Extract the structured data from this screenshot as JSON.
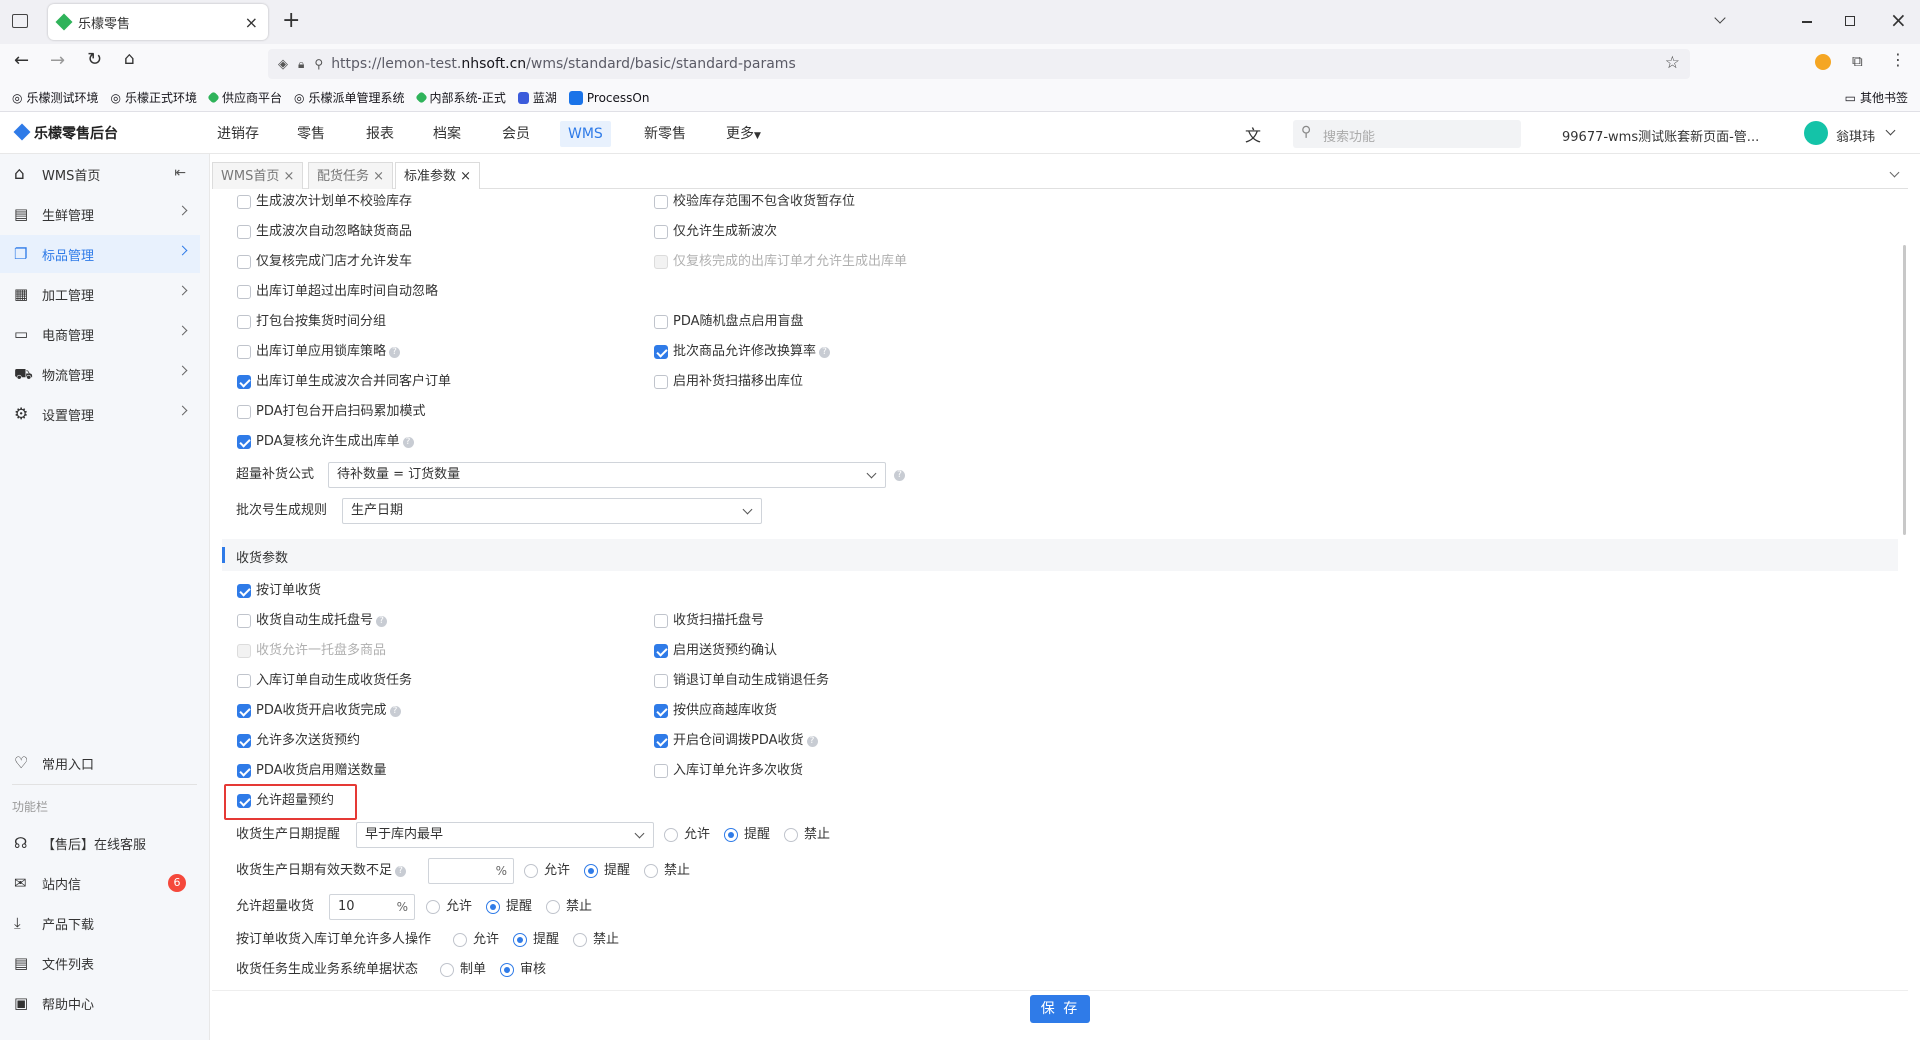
{
  "browser": {
    "tab_title": "乐檬零售",
    "url_prefix": "https://lemon-test.",
    "url_domain": "nhsoft.cn",
    "url_path": "/wms/standard/basic/standard-params",
    "bookmarks": [
      "乐檬测试环境",
      "乐檬正式环境",
      "供应商平台",
      "乐檬派单管理系统",
      "内部系统-正式",
      "蓝湖",
      "ProcessOn"
    ],
    "other_bookmarks": "其他书签"
  },
  "header": {
    "logo": "乐檬零售后台",
    "nav": [
      "进销存",
      "零售",
      "报表",
      "档案",
      "会员",
      "WMS",
      "新零售",
      "更多"
    ],
    "active_nav": "WMS",
    "search_placeholder": "搜索功能",
    "account": "99677-wms测试账套新页面-管...",
    "user": "翁琪玮"
  },
  "sidebar": {
    "items": [
      "WMS首页",
      "生鲜管理",
      "标品管理",
      "加工管理",
      "电商管理",
      "物流管理",
      "设置管理"
    ],
    "active": "标品管理",
    "common_entry": "常用入口",
    "func_bar": "功能栏",
    "func_items": [
      "【售后】在线客服",
      "站内信",
      "产品下载",
      "文件列表",
      "帮助中心"
    ],
    "message_badge": "6"
  },
  "page_tabs": [
    "WMS首页",
    "配货任务",
    "标准参数"
  ],
  "active_tab": "标准参数",
  "shipping_options": {
    "left": [
      {
        "label": "生成波次计划单不校验库存",
        "checked": false
      },
      {
        "label": "生成波次自动忽略缺货商品",
        "checked": false
      },
      {
        "label": "仅复核完成门店才允许发车",
        "checked": false
      },
      {
        "label": "出库订单超过出库时间自动忽略",
        "checked": false
      },
      {
        "label": "打包台按集货时间分组",
        "checked": false
      },
      {
        "label": "出库订单应用锁库策略",
        "checked": false,
        "help": true
      },
      {
        "label": "出库订单生成波次合并同客户订单",
        "checked": true
      },
      {
        "label": "PDA打包台开启扫码累加模式",
        "checked": false
      },
      {
        "label": "PDA复核允许生成出库单",
        "checked": true,
        "help": true
      }
    ],
    "right": [
      {
        "label": "校验库存范围不包含收货暂存位",
        "checked": false
      },
      {
        "label": "仅允许生成新波次",
        "checked": false
      },
      {
        "label": "仅复核完成的出库订单才允许生成出库单",
        "checked": false,
        "disabled": true
      },
      {
        "label": "PDA随机盘点启用盲盘",
        "checked": false
      },
      {
        "label": "批次商品允许修改换算率",
        "checked": true,
        "help": true
      },
      {
        "label": "启用补货扫描移出库位",
        "checked": false
      }
    ],
    "overfill_label": "超量补货公式",
    "overfill_value": "待补数量 = 订货数量",
    "batch_label": "批次号生成规则",
    "batch_value": "生产日期"
  },
  "receiving": {
    "section_title": "收货参数",
    "by_order": {
      "label": "按订单收货",
      "checked": true
    },
    "left": [
      {
        "label": "收货自动生成托盘号",
        "checked": false,
        "help": true
      },
      {
        "label": "收货允许一托盘多商品",
        "checked": false,
        "disabled": true
      },
      {
        "label": "入库订单自动生成收货任务",
        "checked": false
      },
      {
        "label": "PDA收货开启收货完成",
        "checked": true,
        "help": true
      },
      {
        "label": "允许多次送货预约",
        "checked": true
      },
      {
        "label": "PDA收货启用赠送数量",
        "checked": true
      },
      {
        "label": "允许超量预约",
        "checked": true
      }
    ],
    "right": [
      {
        "label": "收货扫描托盘号",
        "checked": false
      },
      {
        "label": "启用送货预约确认",
        "checked": true
      },
      {
        "label": "销退订单自动生成销退任务",
        "checked": false
      },
      {
        "label": "按供应商越库收货",
        "checked": true
      },
      {
        "label": "开启仓间调拨PDA收货",
        "checked": true,
        "help": true
      },
      {
        "label": "入库订单允许多次收货",
        "checked": false
      }
    ],
    "prod_date_label": "收货生产日期提醒",
    "prod_date_value": "早于库内最早",
    "valid_days_label": "收货生产日期有效天数不足",
    "valid_days_value": "",
    "over_recv_label": "允许超量收货",
    "over_recv_value": "10",
    "multi_user_label": "按订单收货入库订单允许多人操作",
    "task_status_label": "收货任务生成业务系统单据状态",
    "pct": "%",
    "opt_allow": "允许",
    "opt_remind": "提醒",
    "opt_forbid": "禁止",
    "opt_draft": "制单",
    "opt_audit": "审核",
    "selected_rule": "提醒",
    "selected_status": "审核"
  },
  "save_label": "保 存",
  "colors": {
    "accent": "#2f7be8",
    "highlight": "#e53935"
  }
}
